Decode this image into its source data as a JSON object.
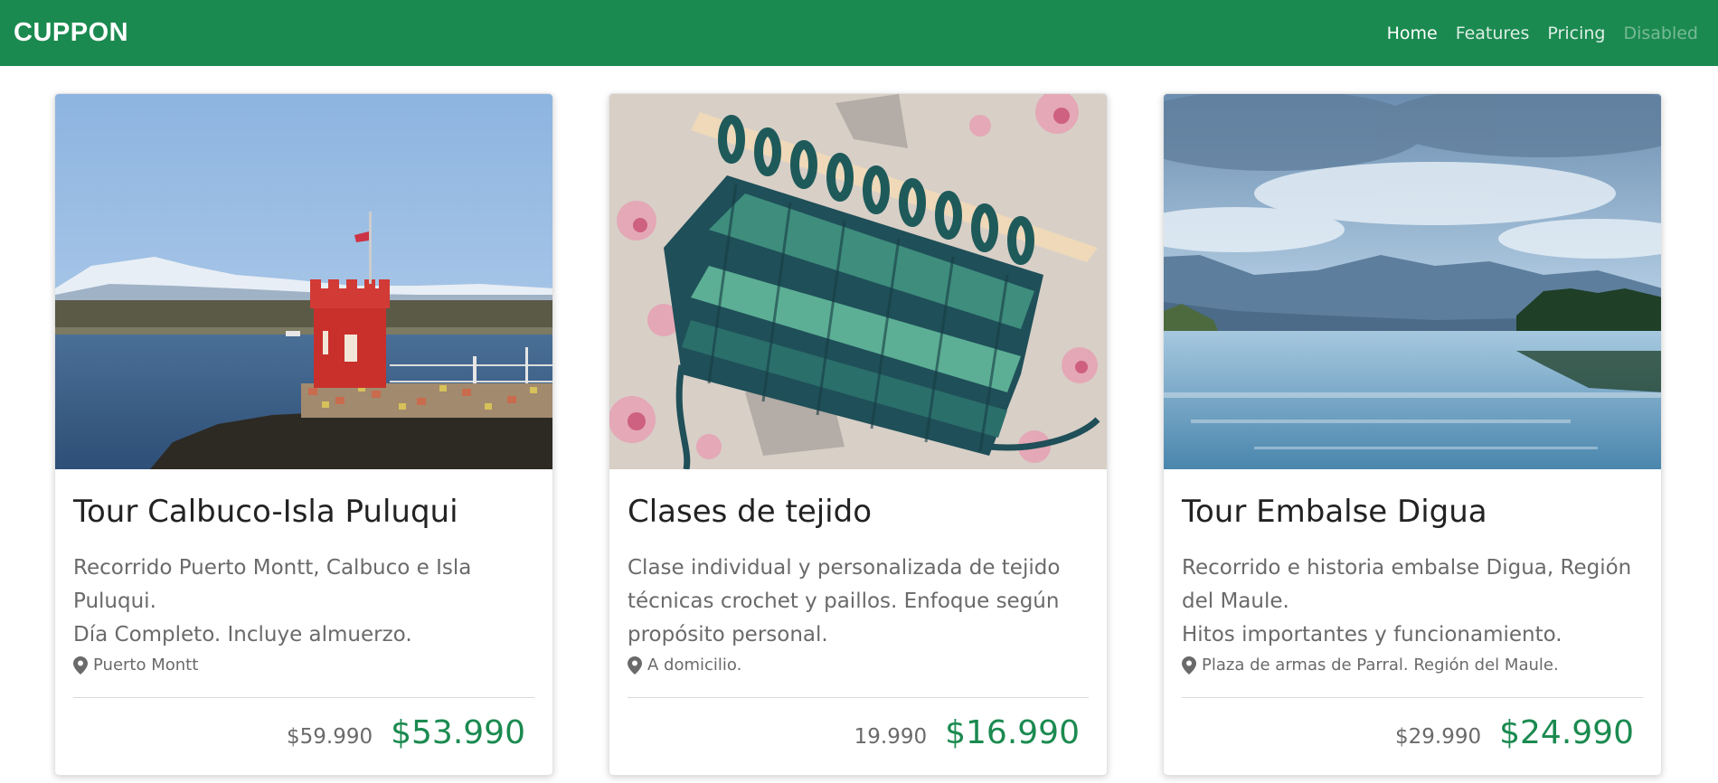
{
  "navbar": {
    "brand": "CUPPON",
    "links": [
      {
        "label": "Home",
        "state": "active"
      },
      {
        "label": "Features",
        "state": "normal"
      },
      {
        "label": "Pricing",
        "state": "normal"
      },
      {
        "label": "Disabled",
        "state": "disabled"
      }
    ],
    "background_color": "#1b8a50"
  },
  "cards": [
    {
      "image": "lighthouse-fort-on-island-photo",
      "title": "Tour Calbuco-Isla Puluqui",
      "description_line1": "Recorrido Puerto Montt, Calbuco e Isla Puluqui.",
      "description_line2": "Día Completo. Incluye almuerzo.",
      "location_icon": "map-marker-icon",
      "location": "Puerto Montt",
      "old_price": "$59.990",
      "new_price": "$53.990"
    },
    {
      "image": "knitting-needle-green-yarn-photo",
      "title": "Clases de tejido",
      "description_line1": "Clase individual y personalizada de tejido técnicas crochet y paillos. Enfoque según propósito personal.",
      "description_line2": "",
      "location_icon": "map-marker-icon",
      "location": "A domicilio.",
      "old_price": "19.990",
      "new_price": "$16.990"
    },
    {
      "image": "reservoir-lake-mountains-photo",
      "title": "Tour Embalse Digua",
      "description_line1": "Recorrido e historia embalse Digua, Región del Maule.",
      "description_line2": "Hitos importantes y funcionamiento.",
      "location_icon": "map-marker-icon",
      "location": "Plaza de armas de Parral. Región del Maule.",
      "old_price": "$29.990",
      "new_price": "$24.990"
    }
  ],
  "colors": {
    "accent": "#1b8a50",
    "muted_text": "#6a6a6a",
    "title_text": "#222222"
  }
}
